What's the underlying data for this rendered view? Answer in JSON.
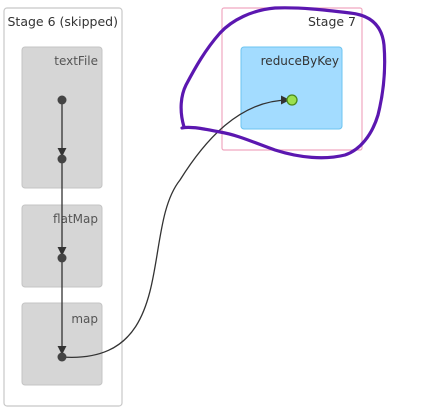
{
  "stages": [
    {
      "id": "stage6",
      "label": "Stage 6 (skipped)",
      "operations": [
        "textFile",
        "flatMap",
        "map"
      ]
    },
    {
      "id": "stage7",
      "label": "Stage 7",
      "operations": [
        "reduceByKey"
      ]
    }
  ],
  "colors": {
    "skipped_stage_border": "#c8c8c8",
    "skipped_cluster_fill": "#d6d6d6",
    "active_stage_border": "#f0a8c0",
    "active_cluster_fill": "#a3dcff",
    "active_cluster_border": "#6cc4f0",
    "edge": "#333333",
    "node": "#444444",
    "cached_node_fill": "#9be04f",
    "cached_node_stroke": "#4a8a1c",
    "highlight_annotation": "#5b17b0"
  }
}
